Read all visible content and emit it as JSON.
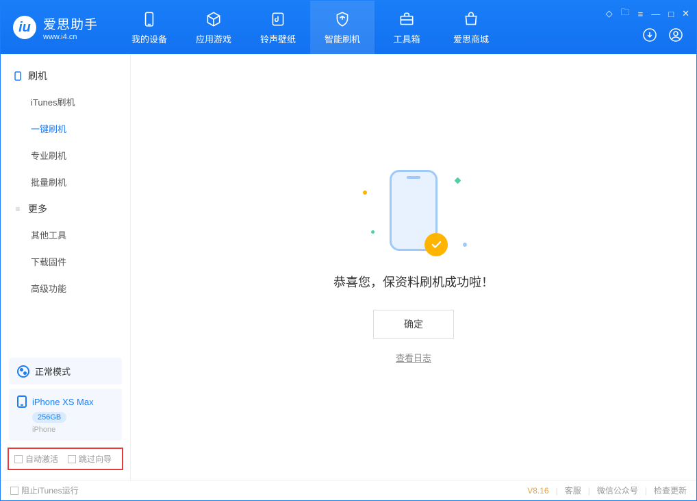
{
  "app": {
    "title": "爱思助手",
    "subtitle": "www.i4.cn"
  },
  "nav": {
    "items": [
      {
        "label": "我的设备",
        "icon": "device"
      },
      {
        "label": "应用游戏",
        "icon": "cube"
      },
      {
        "label": "铃声壁纸",
        "icon": "music"
      },
      {
        "label": "智能刷机",
        "icon": "shield"
      },
      {
        "label": "工具箱",
        "icon": "toolbox"
      },
      {
        "label": "爱思商城",
        "icon": "shop"
      }
    ],
    "active_index": 3
  },
  "sidebar": {
    "sections": [
      {
        "title": "刷机",
        "items": [
          "iTunes刷机",
          "一键刷机",
          "专业刷机",
          "批量刷机"
        ],
        "active_item": "一键刷机"
      },
      {
        "title": "更多",
        "items": [
          "其他工具",
          "下载固件",
          "高级功能"
        ]
      }
    ],
    "mode": {
      "label": "正常模式"
    },
    "device": {
      "name": "iPhone XS Max",
      "capacity": "256GB",
      "type": "iPhone"
    },
    "options": {
      "auto_activate": "自动激活",
      "skip_guide": "跳过向导"
    }
  },
  "main": {
    "success_text": "恭喜您，保资料刷机成功啦！",
    "ok_button": "确定",
    "view_log": "查看日志"
  },
  "footer": {
    "prevent_itunes": "阻止iTunes运行",
    "version": "V8.16",
    "links": [
      "客服",
      "微信公众号",
      "检查更新"
    ]
  }
}
